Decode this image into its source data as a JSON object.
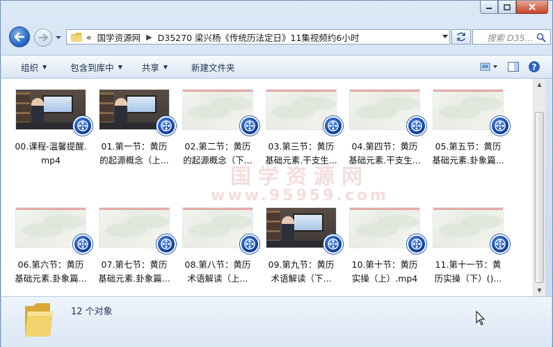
{
  "window": {
    "breadcrumb": [
      "国学资源网",
      "D35270 梁兴杨《传统历法定日》11集视频约6小时"
    ],
    "breadcrumb_prefix": "«",
    "search_placeholder": "搜索 D35..."
  },
  "toolbar": {
    "items": [
      {
        "label": "组织",
        "has_dropdown": true
      },
      {
        "label": "包含到库中",
        "has_dropdown": true
      },
      {
        "label": "共享",
        "has_dropdown": true
      },
      {
        "label": "新建文件夹",
        "has_dropdown": false
      }
    ]
  },
  "files": [
    {
      "line1": "00.课程-温馨提醒.",
      "line2": "mp4",
      "thumb": "studio"
    },
    {
      "line1": "01.第一节：黄历",
      "line2": "的起源概念（上...",
      "thumb": "studio"
    },
    {
      "line1": "02.第二节：黄历",
      "line2": "的起源概念（下...",
      "thumb": "blank"
    },
    {
      "line1": "03.第三节：黄历",
      "line2": "基础元素.干支生...",
      "thumb": "blank"
    },
    {
      "line1": "04.第四节：黄历",
      "line2": "基础元素.干支生...",
      "thumb": "blank"
    },
    {
      "line1": "05.第五节：黄历",
      "line2": "基础元素.卦象篇...",
      "thumb": "blank"
    },
    {
      "line1": "06.第六节：黄历",
      "line2": "基础元素.卦象篇...",
      "thumb": "blank"
    },
    {
      "line1": "07.第七节：黄历",
      "line2": "基础元素.卦象篇...",
      "thumb": "blank"
    },
    {
      "line1": "08.第八节：黄历",
      "line2": "术语解读（上...",
      "thumb": "blank"
    },
    {
      "line1": "09.第九节：黄历",
      "line2": "术语解读（下...",
      "thumb": "studio"
    },
    {
      "line1": "10.第十节：黄历",
      "line2": "实操（上）.mp4",
      "thumb": "blank"
    },
    {
      "line1": "11.第十一节：黄",
      "line2": "历实操（下）()...",
      "thumb": "blank"
    }
  ],
  "watermark": {
    "line1": "国学资源网",
    "line2": "www.95959.com"
  },
  "status": {
    "count": "12 个对象"
  },
  "colors": {
    "accent": "#1f5fbf",
    "toolbar_text": "#1e3350",
    "close": "#c8442b"
  }
}
